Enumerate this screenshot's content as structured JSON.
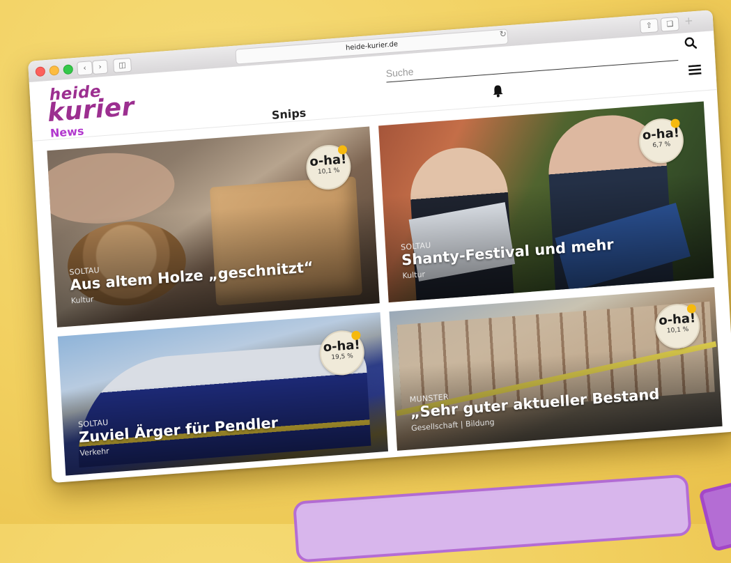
{
  "browser": {
    "url": "heide-kurier.de"
  },
  "site": {
    "logo_top": "heide",
    "logo_bottom": "kurier",
    "nav": {
      "news": "News",
      "snips": "Snips"
    },
    "search_placeholder": "Suche"
  },
  "colors": {
    "brand": "#9c2f90",
    "news_link": "#b238ce",
    "badge_dot": "#f6b90e",
    "background": "#f1cf5e"
  },
  "icons": [
    "back-icon",
    "forward-icon",
    "sidebar-icon",
    "reload-icon",
    "share-icon",
    "tabs-icon",
    "plus-icon",
    "search-icon",
    "bell-icon",
    "menu-icon"
  ],
  "tiles": [
    {
      "location": "SOLTAU",
      "title": "Aus altem Holze „geschnitzt“",
      "category": "Kultur",
      "badge": "o-ha!",
      "badge_value": "10,1 %"
    },
    {
      "location": "SOLTAU",
      "title": "Shanty-Festival und mehr",
      "category": "Kultur",
      "badge": "o-ha!",
      "badge_value": "6,7 %"
    },
    {
      "location": "SOLTAU",
      "title": "Zuviel Ärger für Pendler",
      "category": "Verkehr",
      "badge": "o-ha!",
      "badge_value": "19,5 %"
    },
    {
      "location": "MUNSTER",
      "title": "„Sehr guter aktueller Bestand",
      "category": "Gesellschaft | Bildung",
      "badge": "o-ha!",
      "badge_value": "10,1 %"
    }
  ]
}
